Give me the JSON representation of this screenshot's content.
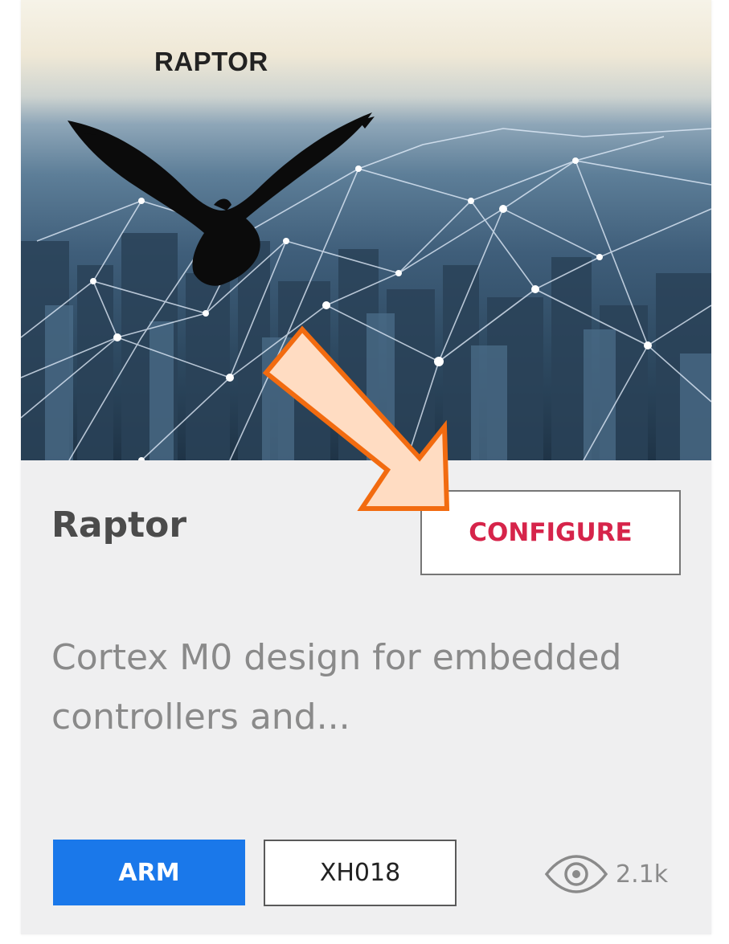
{
  "card": {
    "banner": {
      "title": "RAPTOR",
      "image": "eagle-over-networked-city"
    },
    "title": "Raptor",
    "configure_label": "CONFIGURE",
    "description": "Cortex M0 design for embedded controllers and...",
    "tags": [
      {
        "label": "ARM",
        "style": "primary"
      },
      {
        "label": "XH018",
        "style": "outline"
      }
    ],
    "views": {
      "icon": "eye-icon",
      "count": "2.1k"
    }
  },
  "annotation": {
    "icon": "arrow-annotation",
    "fill": "#ffdcc2",
    "stroke": "#f26b10"
  },
  "colors": {
    "configure_text": "#d6244a",
    "arm_tag_bg": "#1a78ea",
    "card_bg": "#efeff0"
  }
}
